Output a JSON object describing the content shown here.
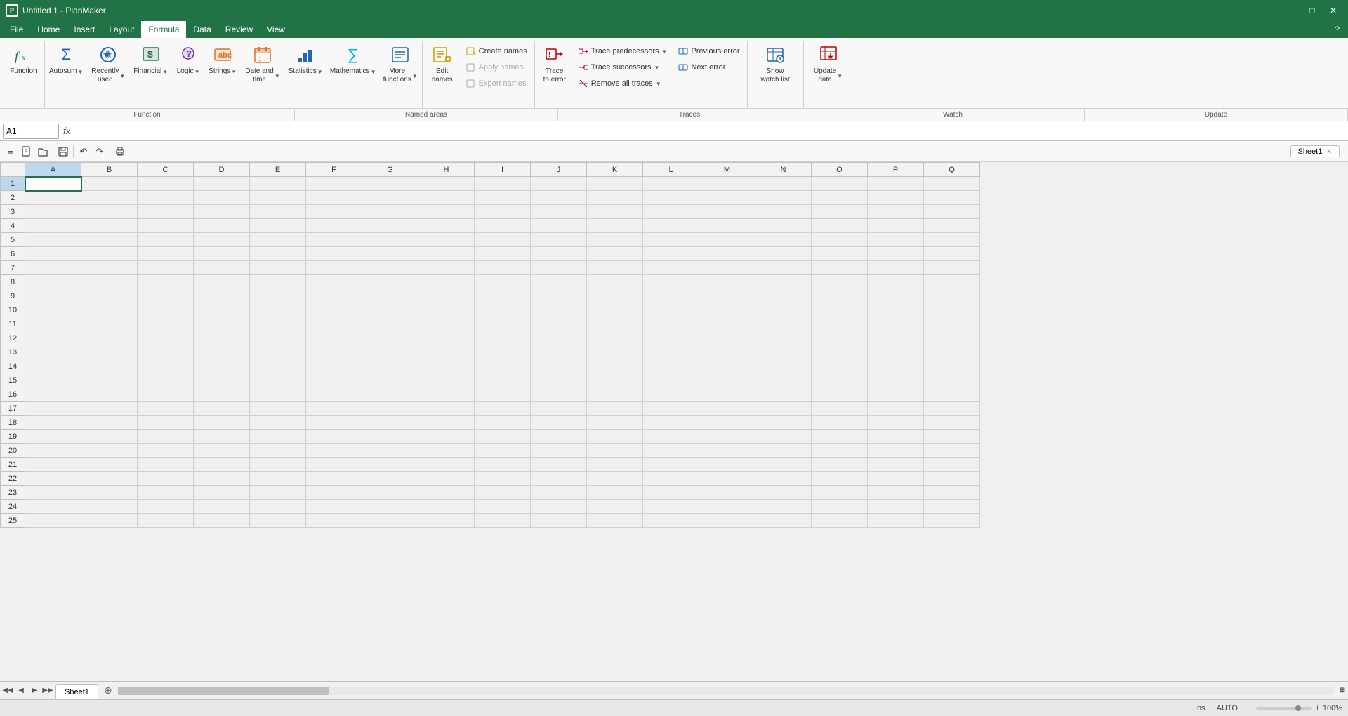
{
  "titleBar": {
    "title": "Untitled 1 - PlanMaker",
    "controls": [
      "─",
      "□",
      "✕"
    ]
  },
  "menuBar": {
    "items": [
      "File",
      "Home",
      "Insert",
      "Layout",
      "Formula",
      "Data",
      "Review",
      "View"
    ],
    "activeItem": "Formula",
    "helpLabel": "?"
  },
  "ribbon": {
    "groups": [
      {
        "name": "function-group",
        "label": "Function",
        "buttons": [
          {
            "id": "function-btn",
            "icon": "𝑓𝑥",
            "iconColor": "icon-green",
            "label": "Function",
            "hasDropdown": false
          }
        ]
      },
      {
        "name": "autosum-group",
        "label": "",
        "buttons": [
          {
            "id": "autosum-btn",
            "icon": "Σ",
            "iconColor": "icon-blue",
            "label": "Autosum",
            "hasDropdown": true
          }
        ]
      },
      {
        "name": "recently-used-group",
        "label": "",
        "buttons": [
          {
            "id": "recently-used-btn",
            "icon": "★",
            "iconColor": "icon-blue",
            "label": "Recently\nused",
            "hasDropdown": true
          }
        ]
      },
      {
        "name": "financial-group",
        "label": "",
        "buttons": [
          {
            "id": "financial-btn",
            "icon": "$",
            "iconColor": "icon-green",
            "label": "Financial",
            "hasDropdown": true
          }
        ]
      },
      {
        "name": "logic-group",
        "label": "",
        "buttons": [
          {
            "id": "logic-btn",
            "icon": "?",
            "iconColor": "icon-purple",
            "label": "Logic",
            "hasDropdown": true
          }
        ]
      },
      {
        "name": "strings-group",
        "label": "",
        "buttons": [
          {
            "id": "strings-btn",
            "icon": "T",
            "iconColor": "icon-orange",
            "label": "Strings",
            "hasDropdown": true
          }
        ]
      },
      {
        "name": "date-time-group",
        "label": "",
        "buttons": [
          {
            "id": "date-time-btn",
            "icon": "📅",
            "iconColor": "icon-orange",
            "label": "Date and\ntime",
            "hasDropdown": true
          }
        ]
      },
      {
        "name": "statistics-group",
        "label": "",
        "buttons": [
          {
            "id": "statistics-btn",
            "icon": "📊",
            "iconColor": "icon-blue",
            "label": "Statistics",
            "hasDropdown": true
          }
        ]
      },
      {
        "name": "mathematics-group",
        "label": "",
        "buttons": [
          {
            "id": "mathematics-btn",
            "icon": "∑",
            "iconColor": "icon-cyan",
            "label": "Mathematics",
            "hasDropdown": true
          }
        ]
      },
      {
        "name": "more-functions-group",
        "label": "",
        "buttons": [
          {
            "id": "more-functions-btn",
            "icon": "≡",
            "iconColor": "icon-blue",
            "label": "More\nfunctions",
            "hasDropdown": true
          }
        ]
      }
    ],
    "groupLabels": [
      {
        "id": "function-label",
        "text": "Function",
        "span": 1
      },
      {
        "id": "named-areas-label",
        "text": "Named areas",
        "span": 1
      },
      {
        "id": "traces-label",
        "text": "Traces",
        "span": 1
      },
      {
        "id": "watch-label",
        "text": "Watch",
        "span": 1
      },
      {
        "id": "update-label",
        "text": "Update",
        "span": 1
      }
    ],
    "namedAreas": {
      "createNames": "Create names",
      "applyNames": "Apply names",
      "exportNames": "Export names",
      "editNames": "Edit\nnames"
    },
    "traces": {
      "tracePredecessors": "Trace predecessors",
      "traceSuccessors": "Trace successors",
      "removeAllTraces": "Remove all traces",
      "traceToError": "Trace\nto error",
      "previousError": "Previous error",
      "nextError": "Next error"
    },
    "watch": {
      "showWatchList": "Show\nwatch list"
    },
    "update": {
      "updateData": "Update\ndata"
    }
  },
  "formulaBar": {
    "cellRef": "A1",
    "fxLabel": "fx",
    "checkLabel": "✓",
    "crossLabel": "✕",
    "formula": ""
  },
  "toolbar": {
    "buttons": [
      "≡",
      "↩",
      "📁",
      "💾",
      "↶",
      "↷",
      "✂",
      "📋"
    ]
  },
  "tabBar": {
    "sheets": [
      {
        "name": "Sheet1",
        "active": true
      }
    ],
    "addLabel": "+"
  },
  "spreadsheet": {
    "columns": [
      "A",
      "B",
      "C",
      "D",
      "E",
      "F",
      "G",
      "H",
      "I",
      "J",
      "K",
      "L",
      "M",
      "N",
      "O",
      "P",
      "Q"
    ],
    "selectedCell": "A1",
    "selectedCol": "A",
    "selectedRow": 1,
    "rowCount": 25
  },
  "statusBar": {
    "leftText": "",
    "insertMode": "Ins",
    "autoMode": "AUTO",
    "zoomLabel": "100%",
    "zoomValue": 100
  }
}
